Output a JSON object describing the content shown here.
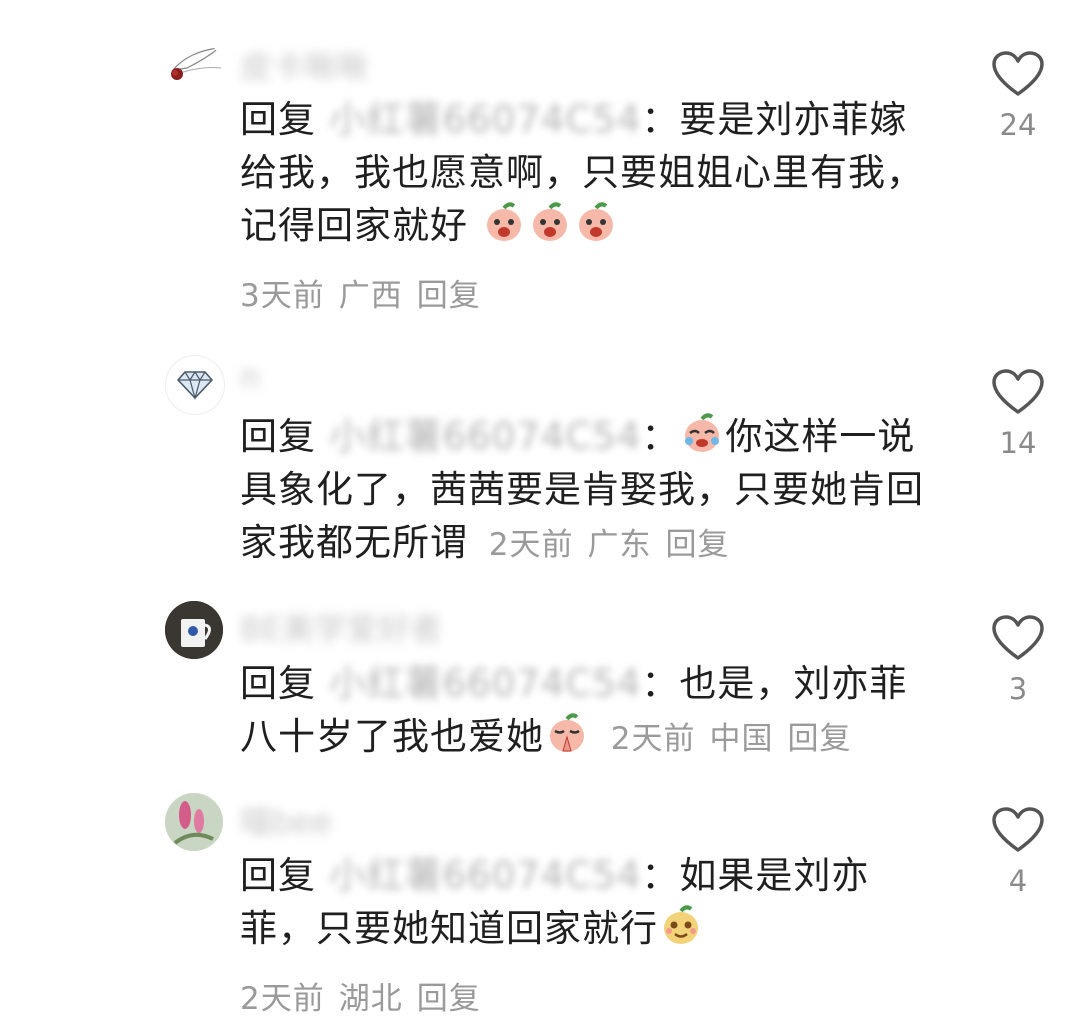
{
  "comments": [
    {
      "username": "皮卡啾啾",
      "reply_label": "回复",
      "reply_target": "小红薯66074C54",
      "text": "要是刘亦菲嫁给我，我也愿意啊，只要姐姐心里有我，记得回家就好",
      "emoji_count": 3,
      "time": "3天前",
      "location": "广西",
      "reply_action": "回复",
      "likes": "24"
    },
    {
      "username": "n",
      "reply_label": "回复",
      "reply_target": "小红薯66074C54",
      "text_after_emoji": "你这样一说具象化了，茜茜要是肯娶我，只要她肯回家我都无所谓",
      "time": "2天前",
      "location": "广东",
      "reply_action": "回复",
      "likes": "14"
    },
    {
      "username": "BE美学爱好者",
      "reply_label": "回复",
      "reply_target": "小红薯66074C54",
      "text": "也是，刘亦菲八十岁了我也爱她",
      "time": "2天前",
      "location": "中国",
      "reply_action": "回复",
      "likes": "3"
    },
    {
      "username": "喵bee",
      "reply_label": "回复",
      "reply_target": "小红薯66074C54",
      "text": "如果是刘亦菲，只要她知道回家就行",
      "time": "2天前",
      "location": "湖北",
      "reply_action": "回复",
      "likes": "4"
    }
  ]
}
